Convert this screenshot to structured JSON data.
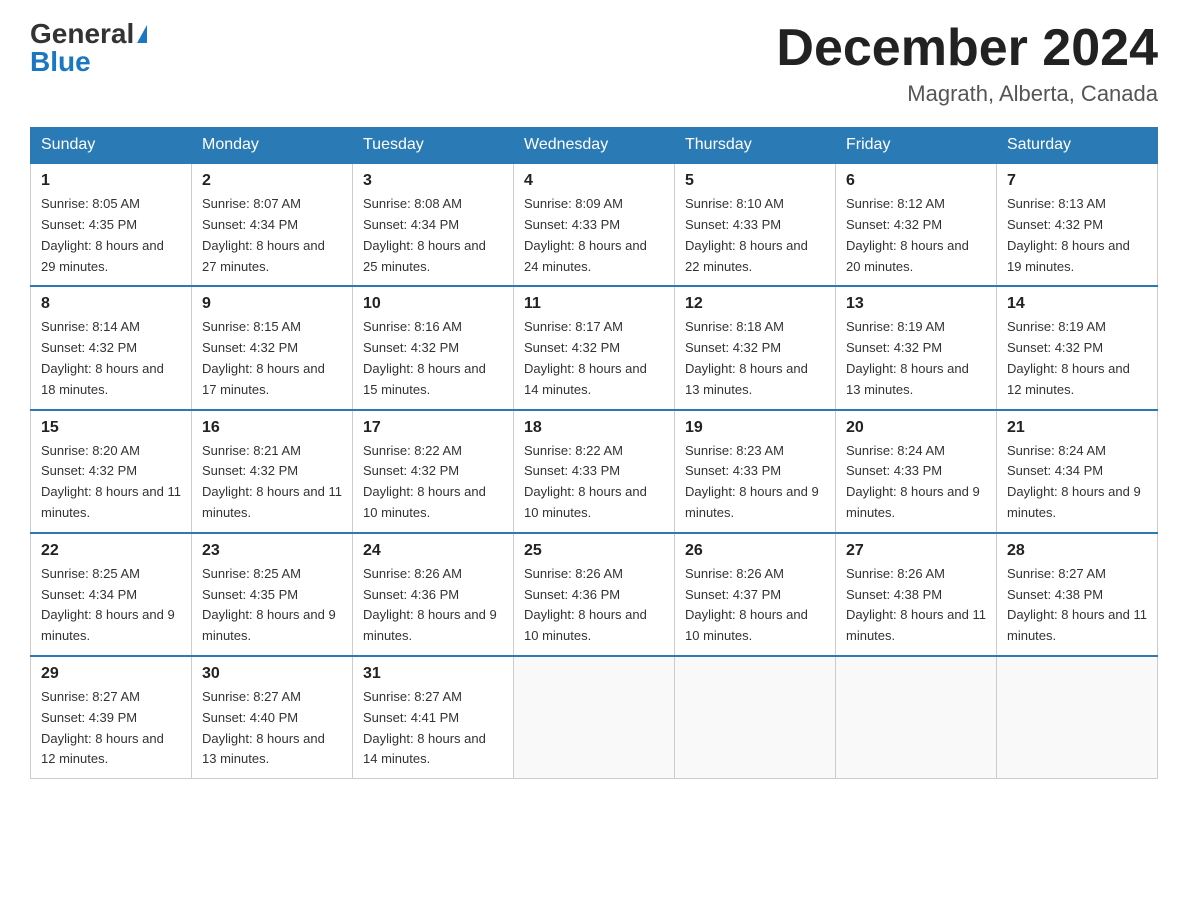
{
  "header": {
    "logo_general": "General",
    "logo_blue": "Blue",
    "month_year": "December 2024",
    "location": "Magrath, Alberta, Canada"
  },
  "days_of_week": [
    "Sunday",
    "Monday",
    "Tuesday",
    "Wednesday",
    "Thursday",
    "Friday",
    "Saturday"
  ],
  "weeks": [
    [
      {
        "day": "1",
        "sunrise": "8:05 AM",
        "sunset": "4:35 PM",
        "daylight": "8 hours and 29 minutes."
      },
      {
        "day": "2",
        "sunrise": "8:07 AM",
        "sunset": "4:34 PM",
        "daylight": "8 hours and 27 minutes."
      },
      {
        "day": "3",
        "sunrise": "8:08 AM",
        "sunset": "4:34 PM",
        "daylight": "8 hours and 25 minutes."
      },
      {
        "day": "4",
        "sunrise": "8:09 AM",
        "sunset": "4:33 PM",
        "daylight": "8 hours and 24 minutes."
      },
      {
        "day": "5",
        "sunrise": "8:10 AM",
        "sunset": "4:33 PM",
        "daylight": "8 hours and 22 minutes."
      },
      {
        "day": "6",
        "sunrise": "8:12 AM",
        "sunset": "4:32 PM",
        "daylight": "8 hours and 20 minutes."
      },
      {
        "day": "7",
        "sunrise": "8:13 AM",
        "sunset": "4:32 PM",
        "daylight": "8 hours and 19 minutes."
      }
    ],
    [
      {
        "day": "8",
        "sunrise": "8:14 AM",
        "sunset": "4:32 PM",
        "daylight": "8 hours and 18 minutes."
      },
      {
        "day": "9",
        "sunrise": "8:15 AM",
        "sunset": "4:32 PM",
        "daylight": "8 hours and 17 minutes."
      },
      {
        "day": "10",
        "sunrise": "8:16 AM",
        "sunset": "4:32 PM",
        "daylight": "8 hours and 15 minutes."
      },
      {
        "day": "11",
        "sunrise": "8:17 AM",
        "sunset": "4:32 PM",
        "daylight": "8 hours and 14 minutes."
      },
      {
        "day": "12",
        "sunrise": "8:18 AM",
        "sunset": "4:32 PM",
        "daylight": "8 hours and 13 minutes."
      },
      {
        "day": "13",
        "sunrise": "8:19 AM",
        "sunset": "4:32 PM",
        "daylight": "8 hours and 13 minutes."
      },
      {
        "day": "14",
        "sunrise": "8:19 AM",
        "sunset": "4:32 PM",
        "daylight": "8 hours and 12 minutes."
      }
    ],
    [
      {
        "day": "15",
        "sunrise": "8:20 AM",
        "sunset": "4:32 PM",
        "daylight": "8 hours and 11 minutes."
      },
      {
        "day": "16",
        "sunrise": "8:21 AM",
        "sunset": "4:32 PM",
        "daylight": "8 hours and 11 minutes."
      },
      {
        "day": "17",
        "sunrise": "8:22 AM",
        "sunset": "4:32 PM",
        "daylight": "8 hours and 10 minutes."
      },
      {
        "day": "18",
        "sunrise": "8:22 AM",
        "sunset": "4:33 PM",
        "daylight": "8 hours and 10 minutes."
      },
      {
        "day": "19",
        "sunrise": "8:23 AM",
        "sunset": "4:33 PM",
        "daylight": "8 hours and 9 minutes."
      },
      {
        "day": "20",
        "sunrise": "8:24 AM",
        "sunset": "4:33 PM",
        "daylight": "8 hours and 9 minutes."
      },
      {
        "day": "21",
        "sunrise": "8:24 AM",
        "sunset": "4:34 PM",
        "daylight": "8 hours and 9 minutes."
      }
    ],
    [
      {
        "day": "22",
        "sunrise": "8:25 AM",
        "sunset": "4:34 PM",
        "daylight": "8 hours and 9 minutes."
      },
      {
        "day": "23",
        "sunrise": "8:25 AM",
        "sunset": "4:35 PM",
        "daylight": "8 hours and 9 minutes."
      },
      {
        "day": "24",
        "sunrise": "8:26 AM",
        "sunset": "4:36 PM",
        "daylight": "8 hours and 9 minutes."
      },
      {
        "day": "25",
        "sunrise": "8:26 AM",
        "sunset": "4:36 PM",
        "daylight": "8 hours and 10 minutes."
      },
      {
        "day": "26",
        "sunrise": "8:26 AM",
        "sunset": "4:37 PM",
        "daylight": "8 hours and 10 minutes."
      },
      {
        "day": "27",
        "sunrise": "8:26 AM",
        "sunset": "4:38 PM",
        "daylight": "8 hours and 11 minutes."
      },
      {
        "day": "28",
        "sunrise": "8:27 AM",
        "sunset": "4:38 PM",
        "daylight": "8 hours and 11 minutes."
      }
    ],
    [
      {
        "day": "29",
        "sunrise": "8:27 AM",
        "sunset": "4:39 PM",
        "daylight": "8 hours and 12 minutes."
      },
      {
        "day": "30",
        "sunrise": "8:27 AM",
        "sunset": "4:40 PM",
        "daylight": "8 hours and 13 minutes."
      },
      {
        "day": "31",
        "sunrise": "8:27 AM",
        "sunset": "4:41 PM",
        "daylight": "8 hours and 14 minutes."
      },
      null,
      null,
      null,
      null
    ]
  ]
}
